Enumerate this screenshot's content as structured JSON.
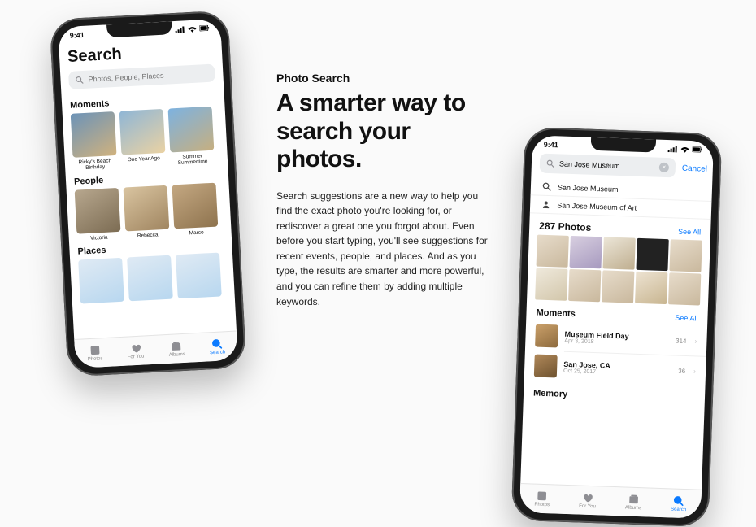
{
  "marketing": {
    "eyebrow": "Photo Search",
    "headline": "A smarter way to search your photos.",
    "body": "Search suggestions are a new way to help you find the exact photo you're looking for, or rediscover a great one you forgot about. Even before you start typing, you'll see suggestions for recent events, people, and places. And as you type, the results are smarter and more powerful, and you can refine them by adding multiple keywords."
  },
  "status": {
    "time": "9:41"
  },
  "phone1": {
    "title": "Search",
    "search_placeholder": "Photos, People, Places",
    "sections": {
      "moments": {
        "title": "Moments",
        "items": [
          {
            "label": "Ricky's Beach Birthday"
          },
          {
            "label": "One Year Ago"
          },
          {
            "label": "Summer Summertime"
          }
        ]
      },
      "people": {
        "title": "People",
        "items": [
          {
            "label": "Victoria"
          },
          {
            "label": "Rebecca"
          },
          {
            "label": "Marco"
          }
        ]
      },
      "places": {
        "title": "Places"
      }
    },
    "tabs": [
      {
        "label": "Photos"
      },
      {
        "label": "For You"
      },
      {
        "label": "Albums"
      },
      {
        "label": "Search"
      }
    ]
  },
  "phone2": {
    "search_value": "San Jose Museum",
    "cancel": "Cancel",
    "suggestions": [
      {
        "icon": "search",
        "label": "San Jose Museum"
      },
      {
        "icon": "person",
        "label": "San Jose Museum of Art"
      }
    ],
    "results": {
      "count_label": "287 Photos",
      "see_all": "See All"
    },
    "moments": {
      "title": "Moments",
      "see_all": "See All",
      "items": [
        {
          "title": "Museum Field Day",
          "date": "Apr 3, 2018",
          "count": "314"
        },
        {
          "title": "San Jose, CA",
          "date": "Oct 25, 2017",
          "count": "36"
        }
      ]
    },
    "memory": {
      "title": "Memory"
    },
    "tabs": [
      {
        "label": "Photos"
      },
      {
        "label": "For You"
      },
      {
        "label": "Albums"
      },
      {
        "label": "Search"
      }
    ]
  }
}
